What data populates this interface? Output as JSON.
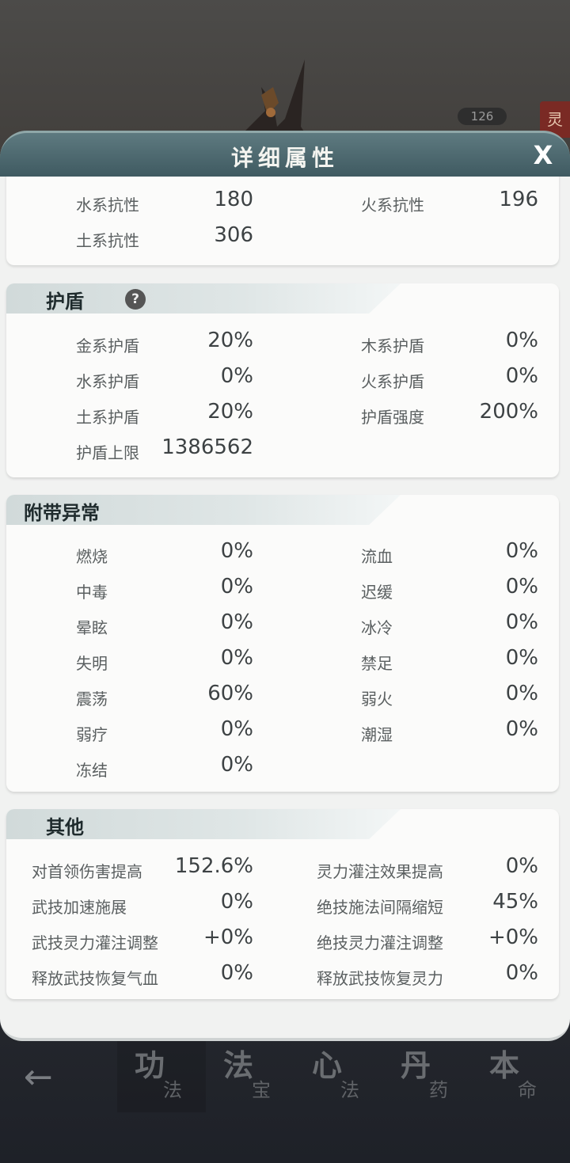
{
  "background": {
    "level_badge": "126",
    "side_tag": "灵"
  },
  "modal": {
    "title": "详细属性",
    "close_label": "X"
  },
  "resistance": {
    "rows": [
      {
        "label": "水系抗性",
        "value": "180"
      },
      {
        "label": "火系抗性",
        "value": "196"
      },
      {
        "label": "土系抗性",
        "value": "306"
      }
    ]
  },
  "shield": {
    "title": "护盾",
    "help_label": "?",
    "rows": [
      {
        "label": "金系护盾",
        "value": "20%"
      },
      {
        "label": "木系护盾",
        "value": "0%"
      },
      {
        "label": "水系护盾",
        "value": "0%"
      },
      {
        "label": "火系护盾",
        "value": "0%"
      },
      {
        "label": "土系护盾",
        "value": "20%"
      },
      {
        "label": "护盾强度",
        "value": "200%"
      },
      {
        "label": "护盾上限",
        "value": "1386562"
      }
    ]
  },
  "abnormal": {
    "title": "附带异常",
    "rows": [
      {
        "label": "燃烧",
        "value": "0%"
      },
      {
        "label": "流血",
        "value": "0%"
      },
      {
        "label": "中毒",
        "value": "0%"
      },
      {
        "label": "迟缓",
        "value": "0%"
      },
      {
        "label": "晕眩",
        "value": "0%"
      },
      {
        "label": "冰冷",
        "value": "0%"
      },
      {
        "label": "失明",
        "value": "0%"
      },
      {
        "label": "禁足",
        "value": "0%"
      },
      {
        "label": "震荡",
        "value": "60%"
      },
      {
        "label": "弱火",
        "value": "0%"
      },
      {
        "label": "弱疗",
        "value": "0%"
      },
      {
        "label": "潮湿",
        "value": "0%"
      },
      {
        "label": "冻结",
        "value": "0%"
      }
    ]
  },
  "other": {
    "title": "其他",
    "rows": [
      {
        "label": "对首领伤害提高",
        "value": "152.6%"
      },
      {
        "label": "灵力灌注效果提高",
        "value": "0%"
      },
      {
        "label": "武技加速施展",
        "value": "0%"
      },
      {
        "label": "绝技施法间隔缩短",
        "value": "45%"
      },
      {
        "label": "武技灵力灌注调整",
        "value": "+0%"
      },
      {
        "label": "绝技灵力灌注调整",
        "value": "+0%"
      },
      {
        "label": "释放武技恢复气血",
        "value": "0%"
      },
      {
        "label": "释放武技恢复灵力",
        "value": "0%"
      }
    ]
  },
  "bottom_nav": {
    "tabs": [
      {
        "big": "功",
        "small": "法"
      },
      {
        "big": "法",
        "small": "宝"
      },
      {
        "big": "心",
        "small": "法"
      },
      {
        "big": "丹",
        "small": "药"
      },
      {
        "big": "本",
        "small": "命"
      }
    ]
  }
}
